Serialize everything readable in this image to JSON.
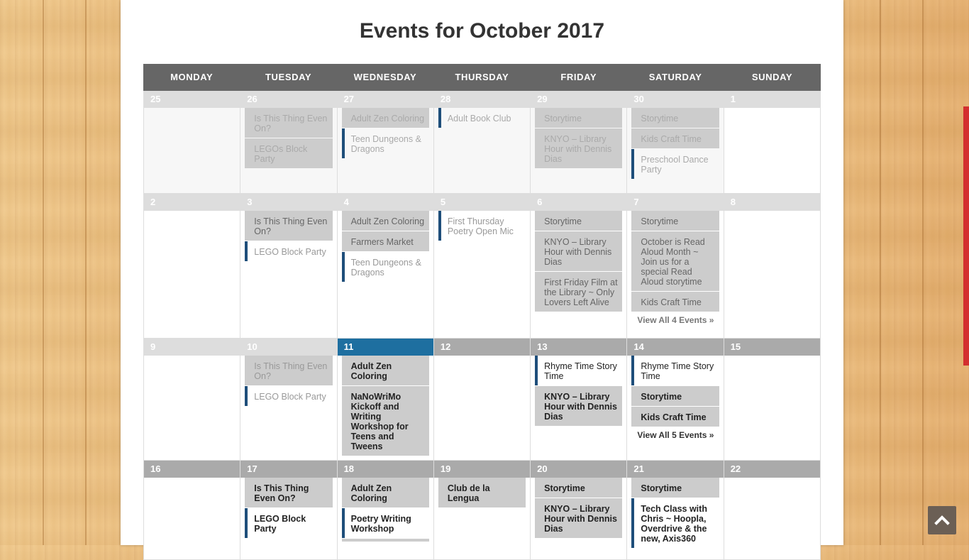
{
  "title": "Events for October 2017",
  "weekdays": [
    "MONDAY",
    "TUESDAY",
    "WEDNESDAY",
    "THURSDAY",
    "FRIDAY",
    "SATURDAY",
    "SUNDAY"
  ],
  "weeks": [
    {
      "days": [
        {
          "num": "25",
          "events": []
        },
        {
          "num": "26",
          "events": [
            {
              "t": "Is This Thing Even On?"
            },
            {
              "t": "LEGOs Block Party"
            }
          ]
        },
        {
          "num": "27",
          "events": [
            {
              "t": "Adult Zen Coloring"
            },
            {
              "t": "Teen Dungeons & Dragons"
            }
          ]
        },
        {
          "num": "28",
          "events": [
            {
              "t": "Adult Book Club"
            }
          ]
        },
        {
          "num": "29",
          "events": [
            {
              "t": "Storytime"
            },
            {
              "t": "KNYO – Library Hour with Dennis Dias"
            }
          ]
        },
        {
          "num": "30",
          "events": [
            {
              "t": "Storytime"
            },
            {
              "t": "Kids Craft Time"
            },
            {
              "t": "Preschool Dance Party"
            }
          ]
        },
        {
          "num": "1",
          "events": []
        }
      ]
    },
    {
      "days": [
        {
          "num": "2",
          "events": []
        },
        {
          "num": "3",
          "events": [
            {
              "t": "Is This Thing Even On?"
            },
            {
              "t": "LEGO Block Party"
            }
          ]
        },
        {
          "num": "4",
          "events": [
            {
              "t": "Adult Zen Coloring"
            },
            {
              "t": "Farmers Market"
            },
            {
              "t": "Teen Dungeons & Dragons"
            }
          ]
        },
        {
          "num": "5",
          "events": [
            {
              "t": "First Thursday Poetry Open Mic"
            }
          ]
        },
        {
          "num": "6",
          "events": [
            {
              "t": "Storytime"
            },
            {
              "t": "KNYO – Library Hour with Dennis Dias"
            },
            {
              "t": "First Friday Film at the Library ~ Only Lovers Left Alive"
            }
          ]
        },
        {
          "num": "7",
          "events": [
            {
              "t": "Storytime"
            },
            {
              "t": "October is Read Aloud Month ~ Join us for a special Read Aloud storytime"
            },
            {
              "t": "Kids Craft Time"
            }
          ],
          "more": "View All 4 Events »"
        },
        {
          "num": "8",
          "events": []
        }
      ]
    },
    {
      "days": [
        {
          "num": "9",
          "events": []
        },
        {
          "num": "10",
          "events": [
            {
              "t": "Is This Thing Even On?"
            },
            {
              "t": "LEGO Block Party"
            }
          ]
        },
        {
          "num": "11",
          "events": [
            {
              "t": "Adult Zen Coloring"
            },
            {
              "t": "NaNoWriMo Kickoff and Writing Workshop for Teens and Tweens"
            }
          ]
        },
        {
          "num": "12",
          "events": []
        },
        {
          "num": "13",
          "events": [
            {
              "t": "Rhyme Time Story Time"
            },
            {
              "t": "KNYO – Library Hour with Dennis Dias"
            }
          ]
        },
        {
          "num": "14",
          "events": [
            {
              "t": "Rhyme Time Story Time"
            },
            {
              "t": "Storytime"
            },
            {
              "t": "Kids Craft Time"
            }
          ],
          "more": "View All 5 Events »"
        },
        {
          "num": "15",
          "events": []
        }
      ]
    },
    {
      "days": [
        {
          "num": "16",
          "events": []
        },
        {
          "num": "17",
          "events": [
            {
              "t": "Is This Thing Even On?"
            },
            {
              "t": "LEGO Block Party"
            }
          ]
        },
        {
          "num": "18",
          "events": [
            {
              "t": "Adult Zen Coloring"
            },
            {
              "t": "Poetry Writing Workshop"
            },
            {
              "t": ""
            }
          ]
        },
        {
          "num": "19",
          "events": [
            {
              "t": "Club de la Lengua"
            }
          ]
        },
        {
          "num": "20",
          "events": [
            {
              "t": "Storytime"
            },
            {
              "t": "KNYO – Library Hour with Dennis Dias"
            }
          ]
        },
        {
          "num": "21",
          "events": [
            {
              "t": "Storytime"
            },
            {
              "t": "Tech Class with Chris ~ Hoopla, Overdrive & the new, Axis360"
            }
          ]
        },
        {
          "num": "22",
          "events": []
        }
      ]
    }
  ],
  "colors": {
    "today": "#1e6fa0",
    "event_bar": "#1e4e7a",
    "header": "#666666"
  },
  "icons": {
    "back_to_top": "chevron-up-icon"
  }
}
